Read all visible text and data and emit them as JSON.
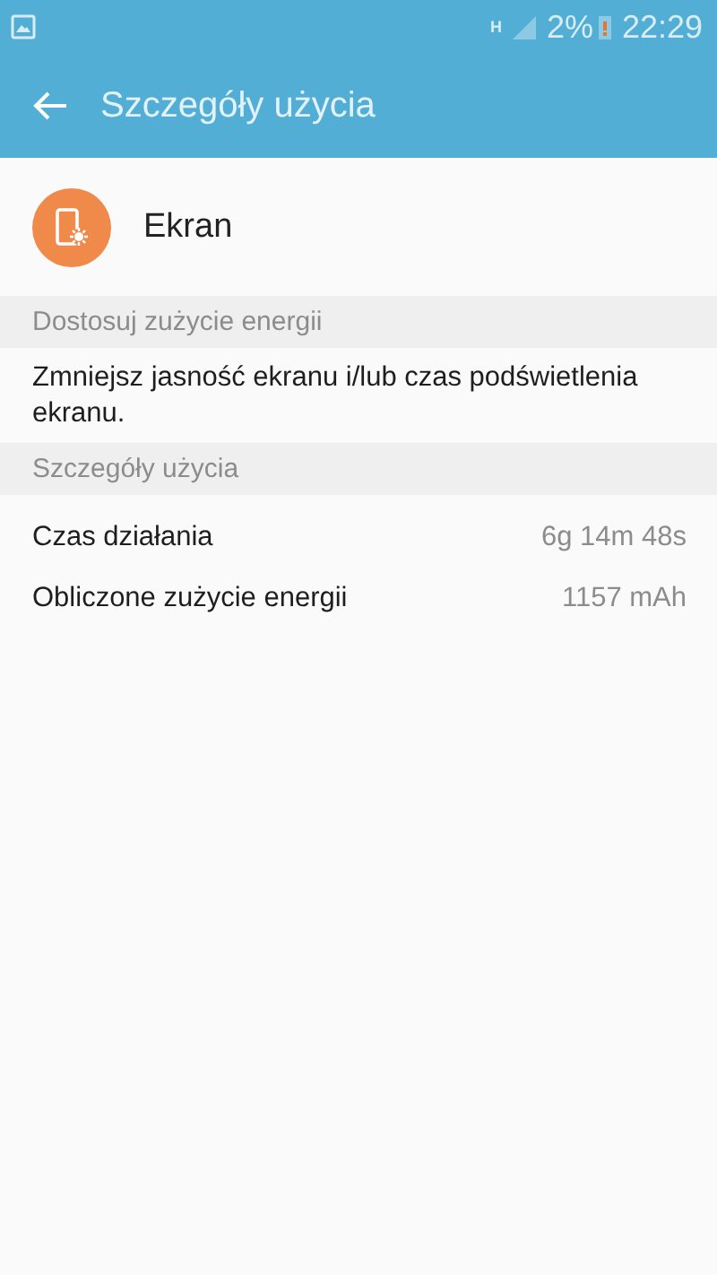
{
  "status_bar": {
    "network_type": "H",
    "battery": "2%",
    "time": "22:29"
  },
  "app_bar": {
    "title": "Szczegóły użycia"
  },
  "app": {
    "name": "Ekran",
    "color": "#f08a4b"
  },
  "sections": [
    {
      "header": "Dostosuj zużycie energii",
      "kind": "text",
      "text": "Zmniejsz jasność ekranu i/lub czas podświetlenia ekranu."
    },
    {
      "header": "Szczegóły użycia",
      "kind": "rows",
      "rows": [
        {
          "label": "Czas działania",
          "value": "6g 14m 48s"
        },
        {
          "label": "Obliczone zużycie energii",
          "value": "1157 mAh"
        }
      ]
    }
  ]
}
